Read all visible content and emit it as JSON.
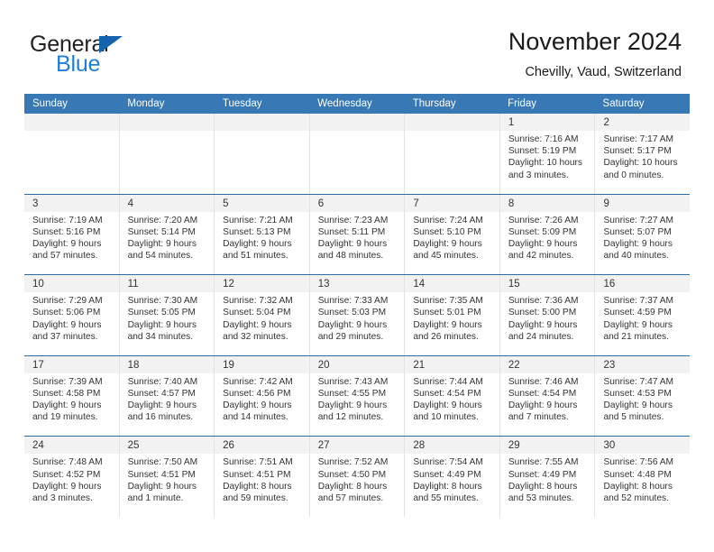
{
  "brand": {
    "name_part1": "General",
    "name_part2": "Blue"
  },
  "header": {
    "title": "November 2024",
    "subtitle": "Chevilly, Vaud, Switzerland"
  },
  "weekdays": [
    "Sunday",
    "Monday",
    "Tuesday",
    "Wednesday",
    "Thursday",
    "Friday",
    "Saturday"
  ],
  "colors": {
    "header_bar": "#3878b4",
    "row_divider": "#2d6da4",
    "day_head_bg": "#f2f2f2",
    "logo_blue": "#1e7fd4",
    "logo_triangle": "#1463ac"
  },
  "weeks": [
    [
      {
        "empty": true
      },
      {
        "empty": true
      },
      {
        "empty": true
      },
      {
        "empty": true
      },
      {
        "empty": true
      },
      {
        "day": "1",
        "sunrise": "Sunrise: 7:16 AM",
        "sunset": "Sunset: 5:19 PM",
        "daylight1": "Daylight: 10 hours",
        "daylight2": "and 3 minutes."
      },
      {
        "day": "2",
        "sunrise": "Sunrise: 7:17 AM",
        "sunset": "Sunset: 5:17 PM",
        "daylight1": "Daylight: 10 hours",
        "daylight2": "and 0 minutes."
      }
    ],
    [
      {
        "day": "3",
        "sunrise": "Sunrise: 7:19 AM",
        "sunset": "Sunset: 5:16 PM",
        "daylight1": "Daylight: 9 hours",
        "daylight2": "and 57 minutes."
      },
      {
        "day": "4",
        "sunrise": "Sunrise: 7:20 AM",
        "sunset": "Sunset: 5:14 PM",
        "daylight1": "Daylight: 9 hours",
        "daylight2": "and 54 minutes."
      },
      {
        "day": "5",
        "sunrise": "Sunrise: 7:21 AM",
        "sunset": "Sunset: 5:13 PM",
        "daylight1": "Daylight: 9 hours",
        "daylight2": "and 51 minutes."
      },
      {
        "day": "6",
        "sunrise": "Sunrise: 7:23 AM",
        "sunset": "Sunset: 5:11 PM",
        "daylight1": "Daylight: 9 hours",
        "daylight2": "and 48 minutes."
      },
      {
        "day": "7",
        "sunrise": "Sunrise: 7:24 AM",
        "sunset": "Sunset: 5:10 PM",
        "daylight1": "Daylight: 9 hours",
        "daylight2": "and 45 minutes."
      },
      {
        "day": "8",
        "sunrise": "Sunrise: 7:26 AM",
        "sunset": "Sunset: 5:09 PM",
        "daylight1": "Daylight: 9 hours",
        "daylight2": "and 42 minutes."
      },
      {
        "day": "9",
        "sunrise": "Sunrise: 7:27 AM",
        "sunset": "Sunset: 5:07 PM",
        "daylight1": "Daylight: 9 hours",
        "daylight2": "and 40 minutes."
      }
    ],
    [
      {
        "day": "10",
        "sunrise": "Sunrise: 7:29 AM",
        "sunset": "Sunset: 5:06 PM",
        "daylight1": "Daylight: 9 hours",
        "daylight2": "and 37 minutes."
      },
      {
        "day": "11",
        "sunrise": "Sunrise: 7:30 AM",
        "sunset": "Sunset: 5:05 PM",
        "daylight1": "Daylight: 9 hours",
        "daylight2": "and 34 minutes."
      },
      {
        "day": "12",
        "sunrise": "Sunrise: 7:32 AM",
        "sunset": "Sunset: 5:04 PM",
        "daylight1": "Daylight: 9 hours",
        "daylight2": "and 32 minutes."
      },
      {
        "day": "13",
        "sunrise": "Sunrise: 7:33 AM",
        "sunset": "Sunset: 5:03 PM",
        "daylight1": "Daylight: 9 hours",
        "daylight2": "and 29 minutes."
      },
      {
        "day": "14",
        "sunrise": "Sunrise: 7:35 AM",
        "sunset": "Sunset: 5:01 PM",
        "daylight1": "Daylight: 9 hours",
        "daylight2": "and 26 minutes."
      },
      {
        "day": "15",
        "sunrise": "Sunrise: 7:36 AM",
        "sunset": "Sunset: 5:00 PM",
        "daylight1": "Daylight: 9 hours",
        "daylight2": "and 24 minutes."
      },
      {
        "day": "16",
        "sunrise": "Sunrise: 7:37 AM",
        "sunset": "Sunset: 4:59 PM",
        "daylight1": "Daylight: 9 hours",
        "daylight2": "and 21 minutes."
      }
    ],
    [
      {
        "day": "17",
        "sunrise": "Sunrise: 7:39 AM",
        "sunset": "Sunset: 4:58 PM",
        "daylight1": "Daylight: 9 hours",
        "daylight2": "and 19 minutes."
      },
      {
        "day": "18",
        "sunrise": "Sunrise: 7:40 AM",
        "sunset": "Sunset: 4:57 PM",
        "daylight1": "Daylight: 9 hours",
        "daylight2": "and 16 minutes."
      },
      {
        "day": "19",
        "sunrise": "Sunrise: 7:42 AM",
        "sunset": "Sunset: 4:56 PM",
        "daylight1": "Daylight: 9 hours",
        "daylight2": "and 14 minutes."
      },
      {
        "day": "20",
        "sunrise": "Sunrise: 7:43 AM",
        "sunset": "Sunset: 4:55 PM",
        "daylight1": "Daylight: 9 hours",
        "daylight2": "and 12 minutes."
      },
      {
        "day": "21",
        "sunrise": "Sunrise: 7:44 AM",
        "sunset": "Sunset: 4:54 PM",
        "daylight1": "Daylight: 9 hours",
        "daylight2": "and 10 minutes."
      },
      {
        "day": "22",
        "sunrise": "Sunrise: 7:46 AM",
        "sunset": "Sunset: 4:54 PM",
        "daylight1": "Daylight: 9 hours",
        "daylight2": "and 7 minutes."
      },
      {
        "day": "23",
        "sunrise": "Sunrise: 7:47 AM",
        "sunset": "Sunset: 4:53 PM",
        "daylight1": "Daylight: 9 hours",
        "daylight2": "and 5 minutes."
      }
    ],
    [
      {
        "day": "24",
        "sunrise": "Sunrise: 7:48 AM",
        "sunset": "Sunset: 4:52 PM",
        "daylight1": "Daylight: 9 hours",
        "daylight2": "and 3 minutes."
      },
      {
        "day": "25",
        "sunrise": "Sunrise: 7:50 AM",
        "sunset": "Sunset: 4:51 PM",
        "daylight1": "Daylight: 9 hours",
        "daylight2": "and 1 minute."
      },
      {
        "day": "26",
        "sunrise": "Sunrise: 7:51 AM",
        "sunset": "Sunset: 4:51 PM",
        "daylight1": "Daylight: 8 hours",
        "daylight2": "and 59 minutes."
      },
      {
        "day": "27",
        "sunrise": "Sunrise: 7:52 AM",
        "sunset": "Sunset: 4:50 PM",
        "daylight1": "Daylight: 8 hours",
        "daylight2": "and 57 minutes."
      },
      {
        "day": "28",
        "sunrise": "Sunrise: 7:54 AM",
        "sunset": "Sunset: 4:49 PM",
        "daylight1": "Daylight: 8 hours",
        "daylight2": "and 55 minutes."
      },
      {
        "day": "29",
        "sunrise": "Sunrise: 7:55 AM",
        "sunset": "Sunset: 4:49 PM",
        "daylight1": "Daylight: 8 hours",
        "daylight2": "and 53 minutes."
      },
      {
        "day": "30",
        "sunrise": "Sunrise: 7:56 AM",
        "sunset": "Sunset: 4:48 PM",
        "daylight1": "Daylight: 8 hours",
        "daylight2": "and 52 minutes."
      }
    ]
  ]
}
